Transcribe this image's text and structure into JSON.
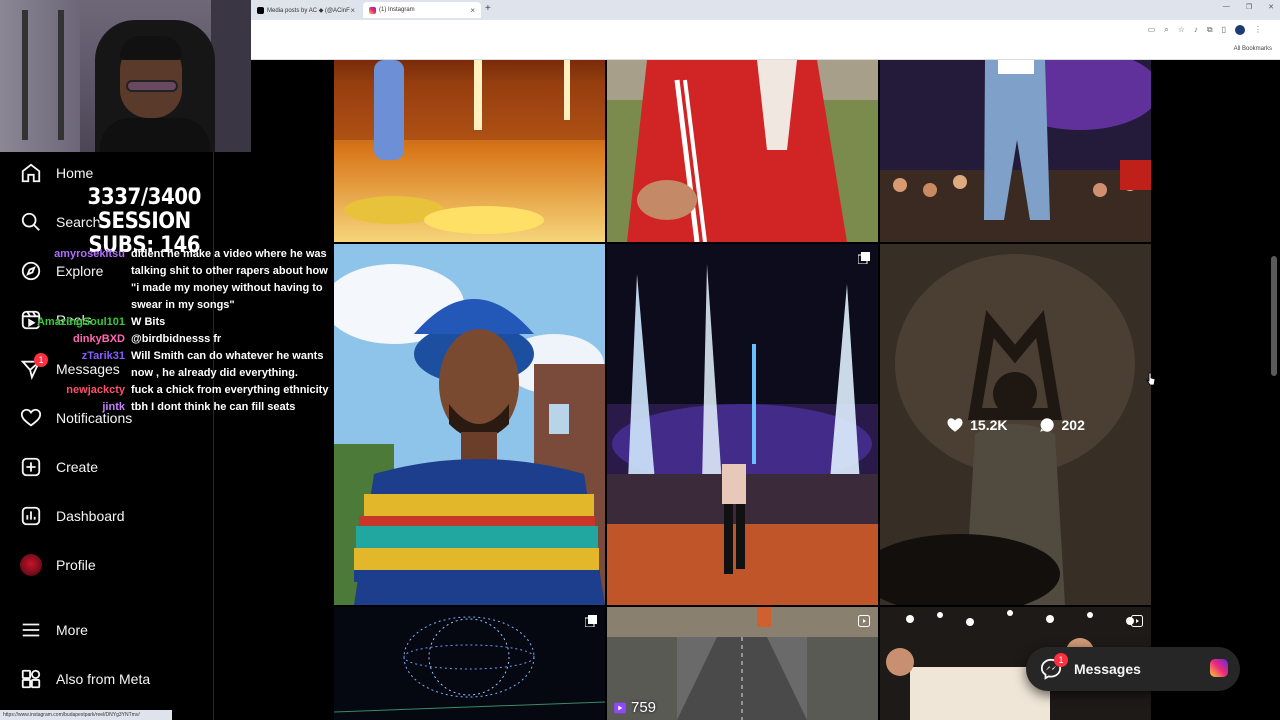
{
  "browser": {
    "tabs": [
      {
        "title": "Media posts by AC ◆ (@ACinF",
        "active": false,
        "favicon_color": "#000000"
      },
      {
        "title": "(1) Instagram",
        "active": true,
        "favicon_color": "#e1306c"
      }
    ],
    "new_tab": "+",
    "bookmarks_label": "All Bookmarks",
    "status_url": "https://www.instagram.com/budapestpark/reel/DNYg3YNTmv/"
  },
  "stream": {
    "sub_goal": "3337/3400",
    "session_subs": "SESSION SUBS: 146",
    "chat": [
      {
        "user": "amyrosekitsu",
        "color": "#b06cff",
        "message": "dident he make a video where he was talking shit to other rapers about how \"i made my money without having to swear in my songs\""
      },
      {
        "user": "AmazingSoul101",
        "color": "#32cd32",
        "message": "W Bits"
      },
      {
        "user": "dinkyBXD",
        "color": "#ff69b4",
        "message": "@birdbidnesss fr"
      },
      {
        "user": "zTarik31",
        "color": "#8a5cff",
        "message": "Will Smith can do whatever he wants now , he already did everything."
      },
      {
        "user": "newjackcty",
        "color": "#ff4d6d",
        "message": "fuck a chick from everything ethnicity"
      },
      {
        "user": "jintk",
        "color": "#c77dff",
        "message": "tbh I dont think he can fill seats"
      }
    ]
  },
  "sidebar": {
    "items": [
      {
        "label": "Home",
        "icon": "home-icon"
      },
      {
        "label": "Search",
        "icon": "search-icon"
      },
      {
        "label": "Explore",
        "icon": "compass-icon"
      },
      {
        "label": "Reels",
        "icon": "reels-icon"
      },
      {
        "label": "Messages",
        "icon": "messenger-icon",
        "badge": "1"
      },
      {
        "label": "Notifications",
        "icon": "heart-icon"
      },
      {
        "label": "Create",
        "icon": "plus-square-icon"
      },
      {
        "label": "Dashboard",
        "icon": "dashboard-icon"
      },
      {
        "label": "Profile",
        "icon": "profile-avatar"
      },
      {
        "label": "More",
        "icon": "menu-icon"
      },
      {
        "label": "Also from Meta",
        "icon": "meta-apps-icon"
      }
    ]
  },
  "grid": {
    "hovered": {
      "likes": "15.2K",
      "comments": "202"
    },
    "reel_views": "759"
  },
  "messages_float": {
    "label": "Messages",
    "badge": "1"
  },
  "colors": {
    "background": "#000000",
    "badge": "#ff3040",
    "pill": "#262626"
  }
}
